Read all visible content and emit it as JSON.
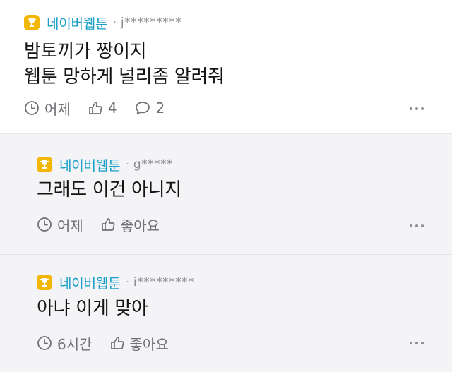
{
  "comments": [
    {
      "source": "네이버웹툰",
      "separator": "·",
      "user": "j*********",
      "text": "밤토끼가 짱이지\n웹툰 망하게 널리좀 알려줘",
      "time": "어제",
      "likes": "4",
      "replies": "2"
    },
    {
      "source": "네이버웹툰",
      "separator": "·",
      "user": "g*****",
      "text": "그래도 이건 아니지",
      "time": "어제",
      "like_label": "좋아요"
    },
    {
      "source": "네이버웹툰",
      "separator": "·",
      "user": "i*********",
      "text": "아냐 이게 맞아",
      "time": "6시간",
      "like_label": "좋아요"
    }
  ],
  "icons": {
    "badge": "trophy-icon",
    "time": "clock-icon",
    "like": "thumbs-up-icon",
    "reply": "speech-bubble-icon",
    "more": "more-dots-icon"
  },
  "colors": {
    "source": "#1aa0c8",
    "badge": "#f2b705",
    "meta": "#707077",
    "reply_background": "#f4f4f6"
  }
}
